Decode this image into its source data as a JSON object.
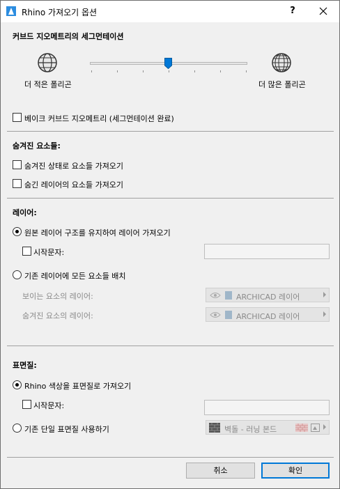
{
  "window": {
    "title": "Rhino 가져오기 옵션",
    "help_label": "?"
  },
  "segmentation": {
    "heading": "커브드 지오메트리의 세그먼테이션",
    "min_label": "더 적은 폴리곤",
    "max_label": "더 많은 폴리곤",
    "slider_level": 0.5,
    "bake_label": "베이크 커브드 지오메트리 (세그먼테이션 완료)",
    "bake_checked": false
  },
  "hidden": {
    "heading": "숨겨진 요소들:",
    "opt1_label": "숨겨진 상태로 요소들 가져오기",
    "opt1_checked": false,
    "opt2_label": "숨긴 레이어의 요소들 가져오기",
    "opt2_checked": false
  },
  "layers": {
    "heading": "레이어:",
    "radio1_label": "원본 레이어 구조를 유지하여 레이어 가져오기",
    "radio1_selected": true,
    "prefix_label": "시작문자:",
    "prefix_value": "",
    "radio2_label": "기존 레이어에 모든 요소들 배치",
    "radio2_selected": false,
    "visible_layer_label": "보이는 요소의 레이어:",
    "visible_layer_value": "ARCHICAD 레이어",
    "hidden_layer_label": "숨겨진 요소의 레이어:",
    "hidden_layer_value": "ARCHICAD 레이어"
  },
  "surfaces": {
    "heading": "표면질:",
    "radio1_label": "Rhino 색상을 표면질로 가져오기",
    "radio1_selected": true,
    "prefix_label": "시작문자:",
    "prefix_value": "",
    "radio2_label": "기존 단일 표면질 사용하기",
    "radio2_selected": false,
    "surface_value": "벽돌 - 러닝 본드"
  },
  "buttons": {
    "cancel": "취소",
    "ok": "확인"
  }
}
